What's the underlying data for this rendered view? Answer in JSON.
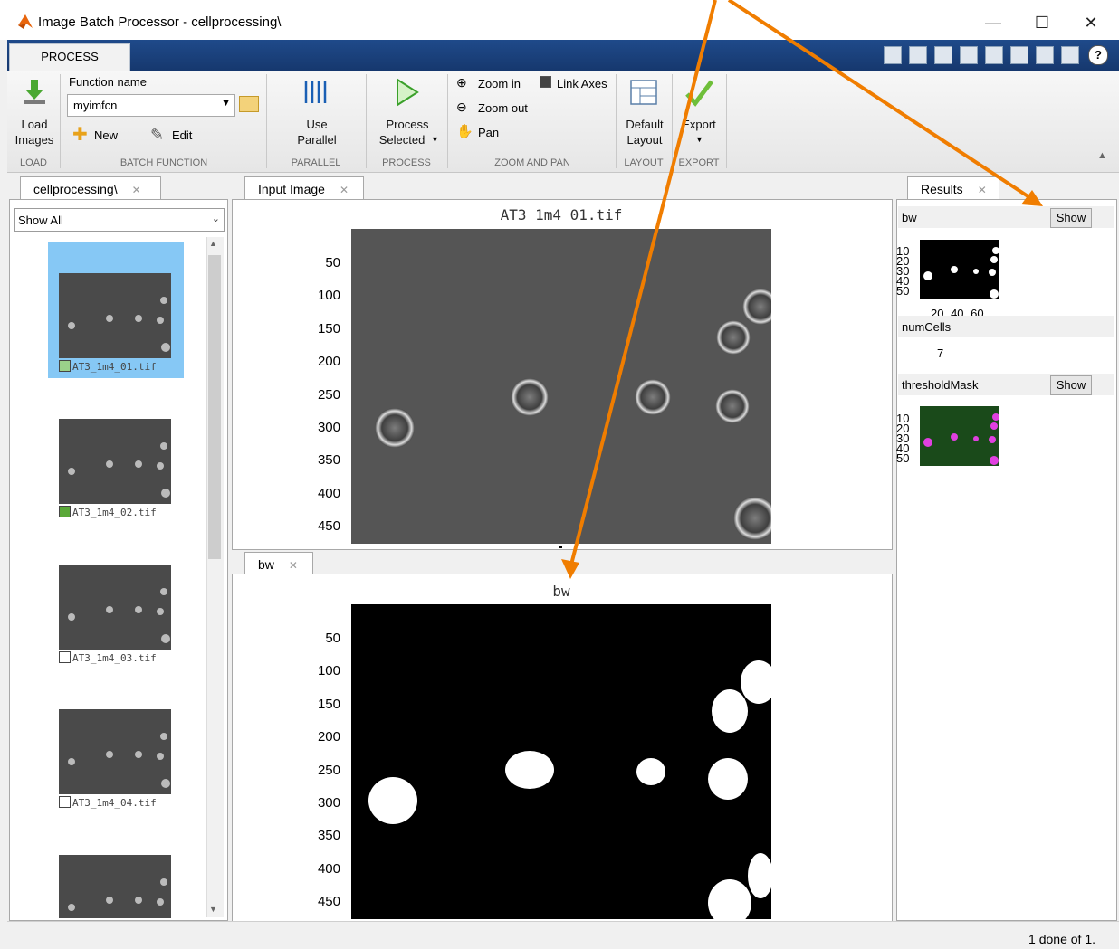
{
  "window": {
    "title": "Image Batch Processor - cellprocessing\\",
    "minimize": "—",
    "maximize": "☐",
    "close": "✕"
  },
  "toolstrip": {
    "tab": "PROCESS",
    "load_label_1": "Load",
    "load_label_2": "Images",
    "function_name_label": "Function name",
    "function_name_value": "myimfcn",
    "new_label": "New",
    "edit_label": "Edit",
    "use_label": "Use",
    "parallel_label": "Parallel",
    "process_label": "Process",
    "selected_label": "Selected",
    "zoom_in": "Zoom in",
    "zoom_out": "Zoom out",
    "pan": "Pan",
    "link_axes": "Link Axes",
    "default_label": "Default",
    "layout_label": "Layout",
    "export_label": "Export",
    "sections": {
      "load": "LOAD",
      "batch": "BATCH FUNCTION",
      "parallel": "PARALLEL",
      "process": "PROCESS",
      "zoom": "ZOOM AND PAN",
      "layout": "LAYOUT",
      "export": "EXPORT"
    }
  },
  "browser": {
    "tab": "cellprocessing\\",
    "filter": "Show All",
    "items": [
      {
        "label": "AT3_1m4_01.tif"
      },
      {
        "label": "AT3_1m4_02.tif"
      },
      {
        "label": "AT3_1m4_03.tif"
      },
      {
        "label": "AT3_1m4_04.tif"
      }
    ]
  },
  "input_panel": {
    "tab": "Input Image",
    "title": "AT3_1m4_01.tif",
    "yticks": [
      "50",
      "100",
      "150",
      "200",
      "250",
      "300",
      "350",
      "400",
      "450"
    ]
  },
  "bw_panel": {
    "tab": "bw",
    "title": "bw",
    "yticks": [
      "50",
      "100",
      "150",
      "200",
      "250",
      "300",
      "350",
      "400",
      "450"
    ]
  },
  "results": {
    "tab": "Results",
    "bw_label": "bw",
    "show": "Show",
    "bw_yticks": [
      "10",
      "20",
      "30",
      "40",
      "50"
    ],
    "bw_xticks": "20 40 60",
    "numcells_label": "numCells",
    "numcells_value": "7",
    "threshold_label": "thresholdMask",
    "th_yticks": [
      "10",
      "20",
      "30",
      "40",
      "50"
    ]
  },
  "status": {
    "text": "1 done of 1."
  },
  "colors": {
    "selected_thumb_bg": "#86c8f5",
    "accent_arrow": "#f07d00",
    "ribbon_dark": "#1f4a8a"
  }
}
